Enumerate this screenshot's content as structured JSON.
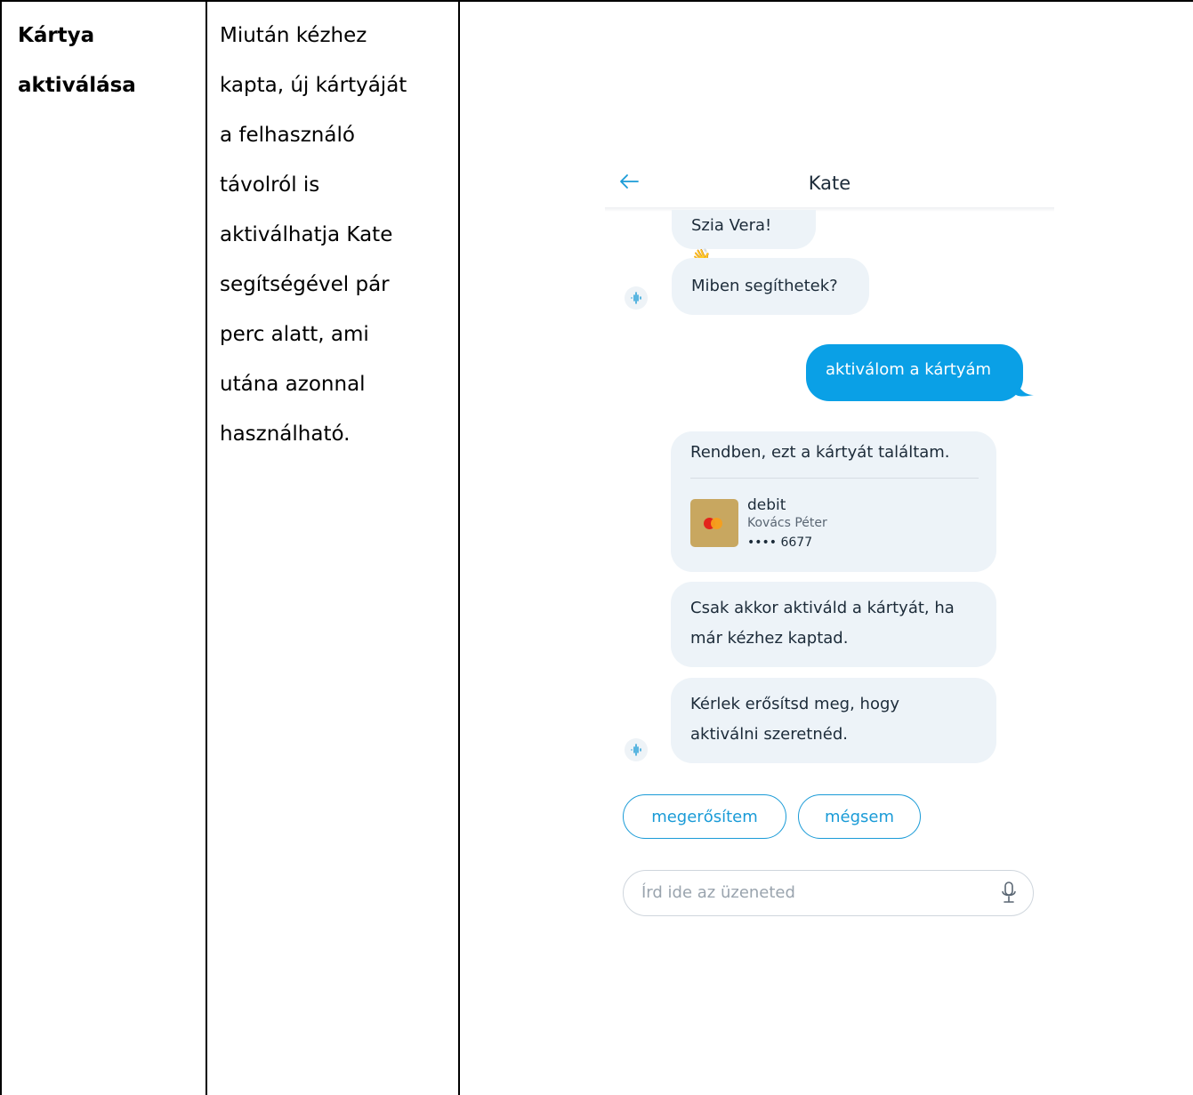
{
  "table": {
    "label_lines": [
      "Kártya",
      "aktiválása"
    ],
    "description_lines": [
      "Miután kézhez",
      "kapta, új kártyáját",
      "a felhasználó",
      "távolról is",
      "aktiválhatja Kate",
      "segítségével pár",
      "perc alatt, ami",
      "utána azonnal",
      "használható."
    ]
  },
  "chat": {
    "title": "Kate",
    "back_icon": "arrow-left-icon",
    "greeting": "Szia Vera! 👋",
    "help_question": "Miben segíthetek?",
    "user_message": "aktiválom a kártyám",
    "card_found_text": "Rendben, ezt a kártyát találtam.",
    "card": {
      "type": "debit",
      "holder": "Kovács Péter",
      "number": "•••• 6677",
      "brand_icon": "mastercard-icon"
    },
    "warning_lines": [
      "Csak akkor aktiváld a kártyát, ha",
      "már kézhez kaptad."
    ],
    "confirm_lines": [
      "Kérlek erősítsd meg, hogy",
      "aktiválni szeretnéd."
    ],
    "quick_replies": {
      "confirm": "megerősítem",
      "cancel": "mégsem"
    },
    "input_placeholder": "Írd ide az üzeneted",
    "mic_icon": "microphone-icon",
    "bot_icon": "voice-wave-icon"
  },
  "colors": {
    "accent": "#0aa0e6",
    "bubble": "#edf3f8",
    "text": "#1c2b39",
    "card_gold": "#c8a760"
  }
}
